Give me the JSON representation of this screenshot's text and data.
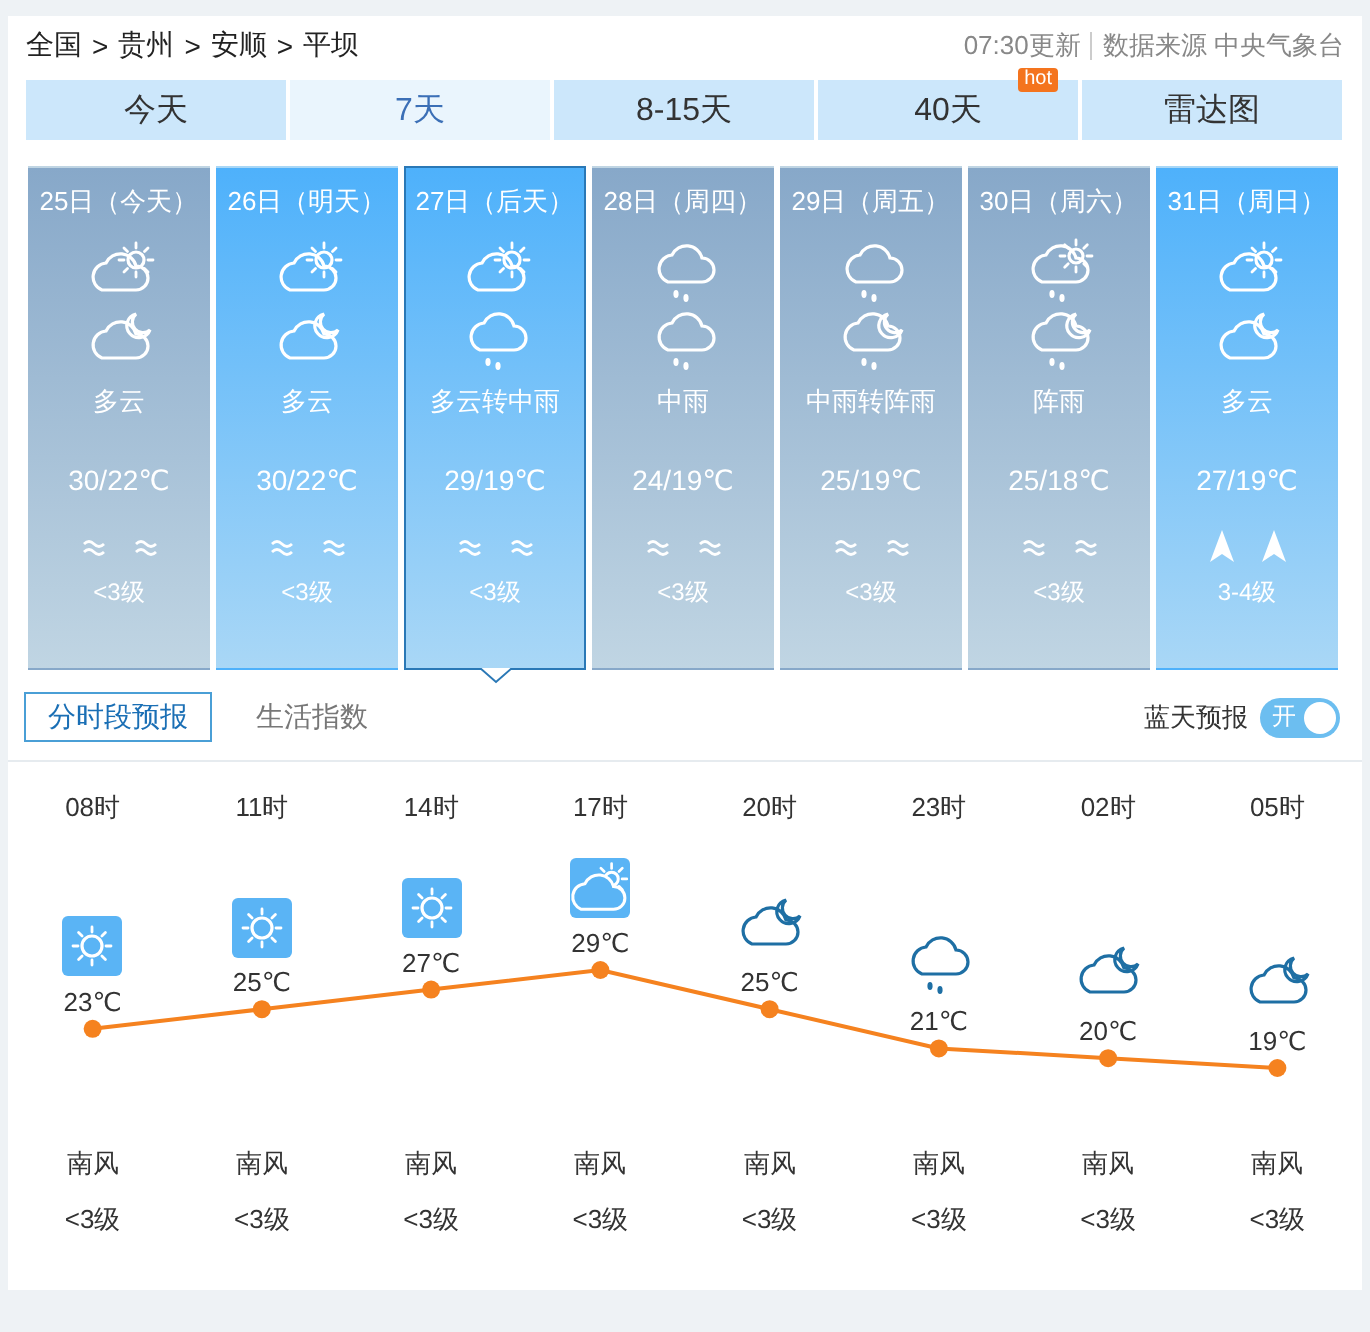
{
  "breadcrumb": [
    {
      "text": "全国",
      "separator": ">"
    },
    {
      "text": "贵州",
      "separator": ">"
    },
    {
      "text": "安顺",
      "separator": ">"
    },
    {
      "text": "平坝"
    }
  ],
  "update": {
    "time": "07:30更新",
    "source": "数据来源 中央气象台"
  },
  "nav_tabs": [
    {
      "label": "今天",
      "selected": false
    },
    {
      "label": "7天",
      "selected": true
    },
    {
      "label": "8-15天",
      "selected": false
    },
    {
      "label": "40天",
      "selected": false,
      "badge": "hot"
    },
    {
      "label": "雷达图",
      "selected": false
    }
  ],
  "days": [
    {
      "date": "25日（今天）",
      "icons": [
        {
          "kind": "cloud_sun"
        },
        {
          "kind": "cloud_moon"
        }
      ],
      "weather": "多云",
      "temp": "30/22℃",
      "wind_icons": [
        {
          "kind": "breeze"
        },
        {
          "kind": "breeze"
        }
      ],
      "wind": "<3级",
      "bright": false,
      "selected": false
    },
    {
      "date": "26日（明天）",
      "icons": [
        {
          "kind": "cloud_sun"
        },
        {
          "kind": "cloud_moon"
        }
      ],
      "weather": "多云",
      "temp": "30/22℃",
      "wind_icons": [
        {
          "kind": "breeze"
        },
        {
          "kind": "breeze"
        }
      ],
      "wind": "<3级",
      "bright": true,
      "selected": false
    },
    {
      "date": "27日（后天）",
      "icons": [
        {
          "kind": "cloud_sun"
        },
        {
          "kind": "rain"
        }
      ],
      "weather": "多云转中雨",
      "temp": "29/19℃",
      "wind_icons": [
        {
          "kind": "breeze"
        },
        {
          "kind": "breeze"
        }
      ],
      "wind": "<3级",
      "bright": true,
      "selected": true
    },
    {
      "date": "28日（周四）",
      "icons": [
        {
          "kind": "rain"
        },
        {
          "kind": "rain"
        }
      ],
      "weather": "中雨",
      "temp": "24/19℃",
      "wind_icons": [
        {
          "kind": "breeze"
        },
        {
          "kind": "breeze"
        }
      ],
      "wind": "<3级",
      "bright": false,
      "selected": false
    },
    {
      "date": "29日（周五）",
      "icons": [
        {
          "kind": "rain"
        },
        {
          "kind": "rain_moon"
        }
      ],
      "weather": "中雨转阵雨",
      "temp": "25/19℃",
      "wind_icons": [
        {
          "kind": "breeze"
        },
        {
          "kind": "breeze"
        }
      ],
      "wind": "<3级",
      "bright": false,
      "selected": false
    },
    {
      "date": "30日（周六）",
      "icons": [
        {
          "kind": "rain_sun"
        },
        {
          "kind": "rain_moon"
        }
      ],
      "weather": "阵雨",
      "temp": "25/18℃",
      "wind_icons": [
        {
          "kind": "breeze"
        },
        {
          "kind": "breeze"
        }
      ],
      "wind": "<3级",
      "bright": false,
      "selected": false
    },
    {
      "date": "31日（周日）",
      "icons": [
        {
          "kind": "cloud_sun"
        },
        {
          "kind": "cloud_moon"
        }
      ],
      "weather": "多云",
      "temp": "27/19℃",
      "wind_icons": [
        {
          "kind": "arrow"
        },
        {
          "kind": "arrow"
        }
      ],
      "wind": "3-4级",
      "bright": true,
      "selected": false
    }
  ],
  "sub_tabs": [
    {
      "label": "分时段预报",
      "selected": true
    },
    {
      "label": "生活指数",
      "selected": false
    }
  ],
  "blue_sky": {
    "label": "蓝天预报",
    "on": true,
    "switch_text": "开"
  },
  "hourly": {
    "chart_data": {
      "type": "line",
      "series": [
        {
          "color": "#f5821f",
          "marker": "circle",
          "values": [
            23,
            25,
            27,
            29,
            25,
            21,
            20,
            19
          ]
        }
      ],
      "data_labels": true
    },
    "temp_unit": "℃",
    "hours": [
      {
        "time": "08时",
        "kind": "sun_box",
        "wind_dir": "南风",
        "wind": "<3级"
      },
      {
        "time": "11时",
        "kind": "sun_box",
        "wind_dir": "南风",
        "wind": "<3级"
      },
      {
        "time": "14时",
        "kind": "sun_box",
        "wind_dir": "南风",
        "wind": "<3级"
      },
      {
        "time": "17时",
        "kind": "cloud_sun_box",
        "wind_dir": "南风",
        "wind": "<3级"
      },
      {
        "time": "20时",
        "kind": "cloud_moon",
        "wind_dir": "南风",
        "wind": "<3级"
      },
      {
        "time": "23时",
        "kind": "rain",
        "wind_dir": "南风",
        "wind": "<3级"
      },
      {
        "time": "02时",
        "kind": "cloud_moon",
        "wind_dir": "南风",
        "wind": "<3级"
      },
      {
        "time": "05时",
        "kind": "cloud_moon",
        "wind_dir": "南风",
        "wind": "<3级"
      }
    ]
  }
}
